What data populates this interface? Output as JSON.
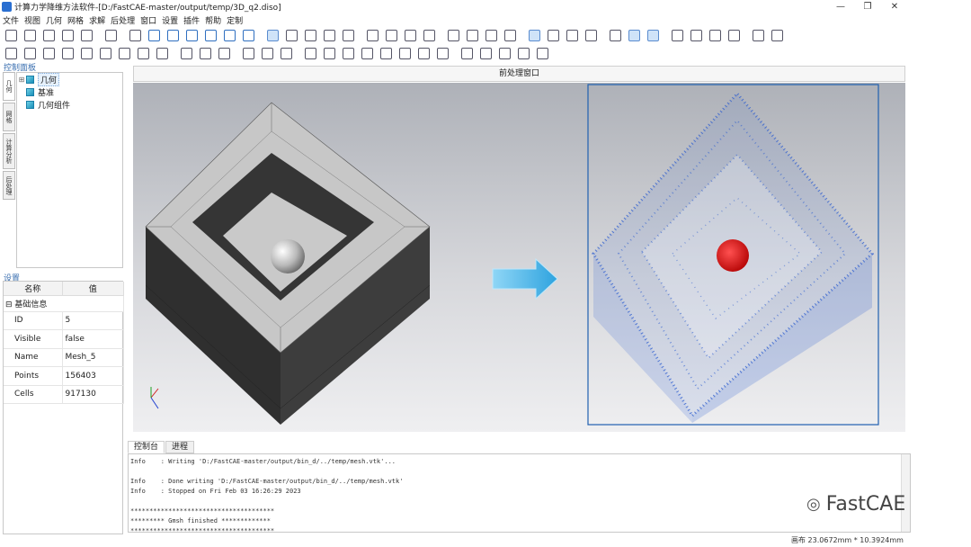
{
  "window": {
    "title": "计算力学降维方法软件-[D:/FastCAE-master/output/temp/3D_q2.diso]",
    "controls": {
      "minimize": "—",
      "maximize": "❐",
      "close": "✕"
    }
  },
  "menu": [
    "文件",
    "视图",
    "几何",
    "网格",
    "求解",
    "后处理",
    "窗口",
    "设置",
    "插件",
    "帮助",
    "定制"
  ],
  "control_panel": {
    "title": "控制面板",
    "tabs": [
      "几何",
      "网格",
      "计算分析",
      "后处理"
    ],
    "tree": [
      {
        "label": "几何",
        "expander": "⊞"
      },
      {
        "label": "基准",
        "expander": ""
      },
      {
        "label": "几何组件",
        "expander": ""
      }
    ]
  },
  "settings": {
    "title": "设置",
    "columns": [
      "名称",
      "值"
    ],
    "group": {
      "expander": "⊟",
      "label": "基础信息"
    },
    "rows": [
      {
        "name": "ID",
        "value": "5"
      },
      {
        "name": "Visible",
        "value": "false"
      },
      {
        "name": "Name",
        "value": "Mesh_5"
      },
      {
        "name": "Points",
        "value": "156403"
      },
      {
        "name": "Cells",
        "value": "917130"
      }
    ]
  },
  "viewport": {
    "title": "前处理窗口"
  },
  "console": {
    "tabs": [
      "控制台",
      "进程"
    ],
    "lines": [
      "Info    : Writing 'D:/FastCAE-master/output/bin_d/../temp/mesh.vtk'...",
      "",
      "Info    : Done writing 'D:/FastCAE-master/output/bin_d/../temp/mesh.vtk'",
      "Info    : Stopped on Fri Feb 03 16:26:29 2023",
      "",
      "**************************************",
      "********* Gmsh finished *************",
      "**************************************"
    ]
  },
  "watermark": {
    "text": "FastCAE",
    "icon": "wechat-icon"
  },
  "status": {
    "canvas_size": "画布 23.0672mm * 10.3924mm"
  },
  "colors": {
    "accent": "#3a6fb0",
    "mesh_points": "#2f5fd0",
    "sphere": "#e01010",
    "arrow": "#4fb8e8",
    "frame": "#2060b0"
  }
}
